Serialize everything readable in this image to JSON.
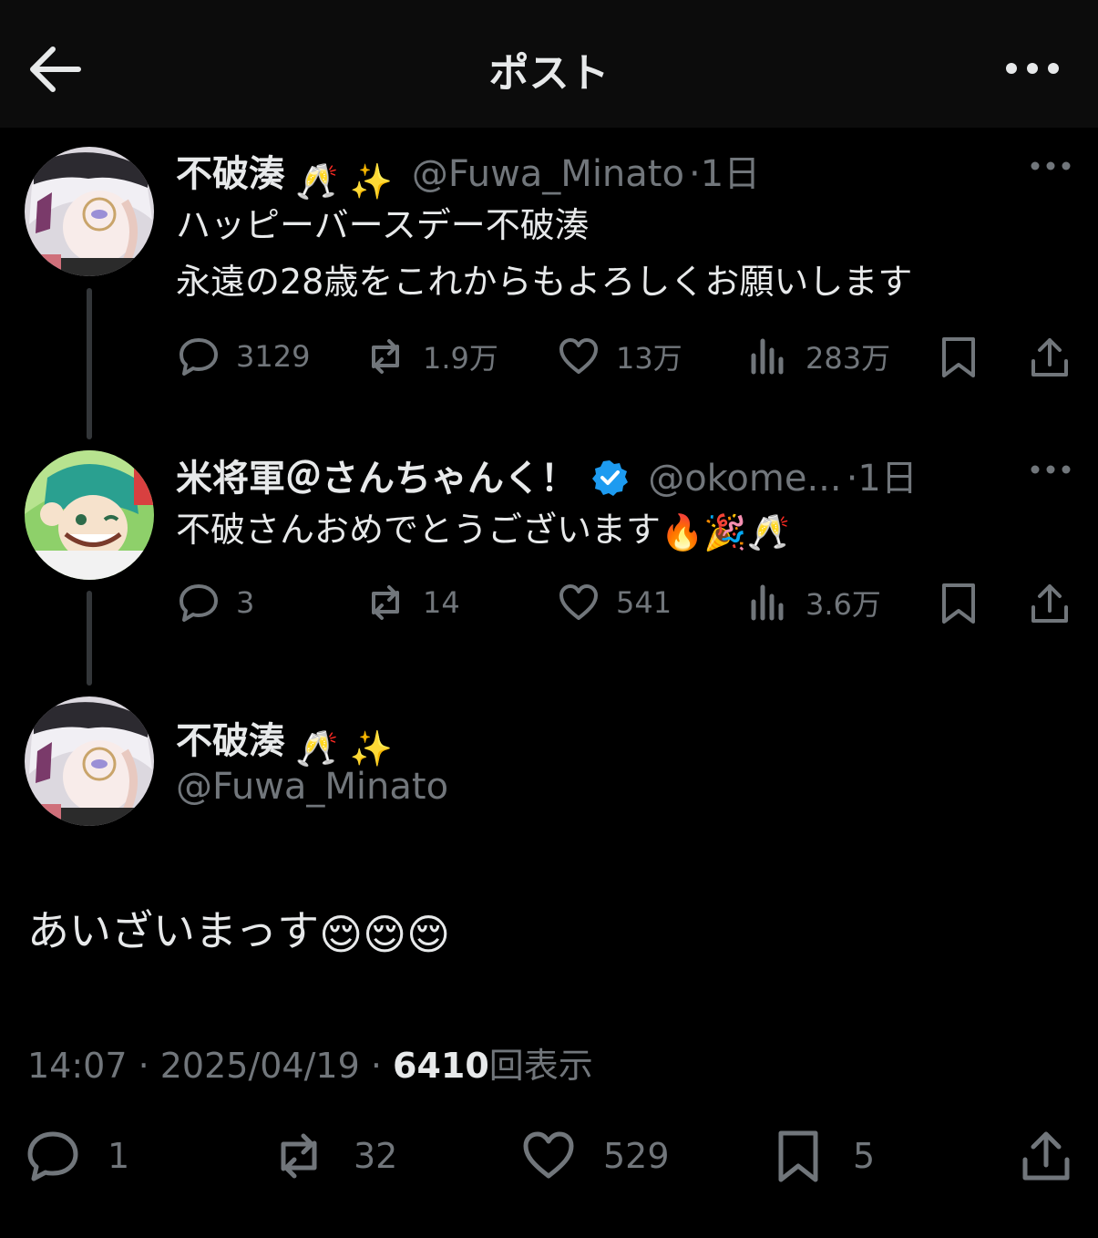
{
  "header": {
    "title": "ポスト"
  },
  "tweets": [
    {
      "name": "不破湊",
      "name_emoji": "🥂 ✨",
      "handle": "@Fuwa_Minato",
      "time": "·1日",
      "lines": [
        "ハッピーバースデー不破湊",
        "永遠の28歳をこれからもよろしくお願いします"
      ],
      "replies": "3129",
      "reposts": "1.9万",
      "likes": "13万",
      "views": "283万"
    },
    {
      "name": "米将軍＠さんちゃんく！",
      "handle": "@okome...",
      "time": "·1日",
      "verified": true,
      "lines": [
        "不破さんおめでとうございます"
      ],
      "line_emoji": "🔥🎉🥂",
      "replies": "3",
      "reposts": "14",
      "likes": "541",
      "views": "3.6万"
    }
  ],
  "main": {
    "name": "不破湊",
    "name_emoji": "🥂 ✨",
    "handle": "@Fuwa_Minato",
    "text": "あいざいまっす",
    "text_emoji": "😌😌😌",
    "time": "14:07 · 2025/04/19 · ",
    "views_count": "6410",
    "views_label": "回表示",
    "replies": "1",
    "reposts": "32",
    "likes": "529",
    "bookmarks": "5"
  },
  "colors": {
    "background": "#000000",
    "text": "#e7e9ea",
    "muted": "#71767b",
    "verified": "#1d9bf0"
  }
}
